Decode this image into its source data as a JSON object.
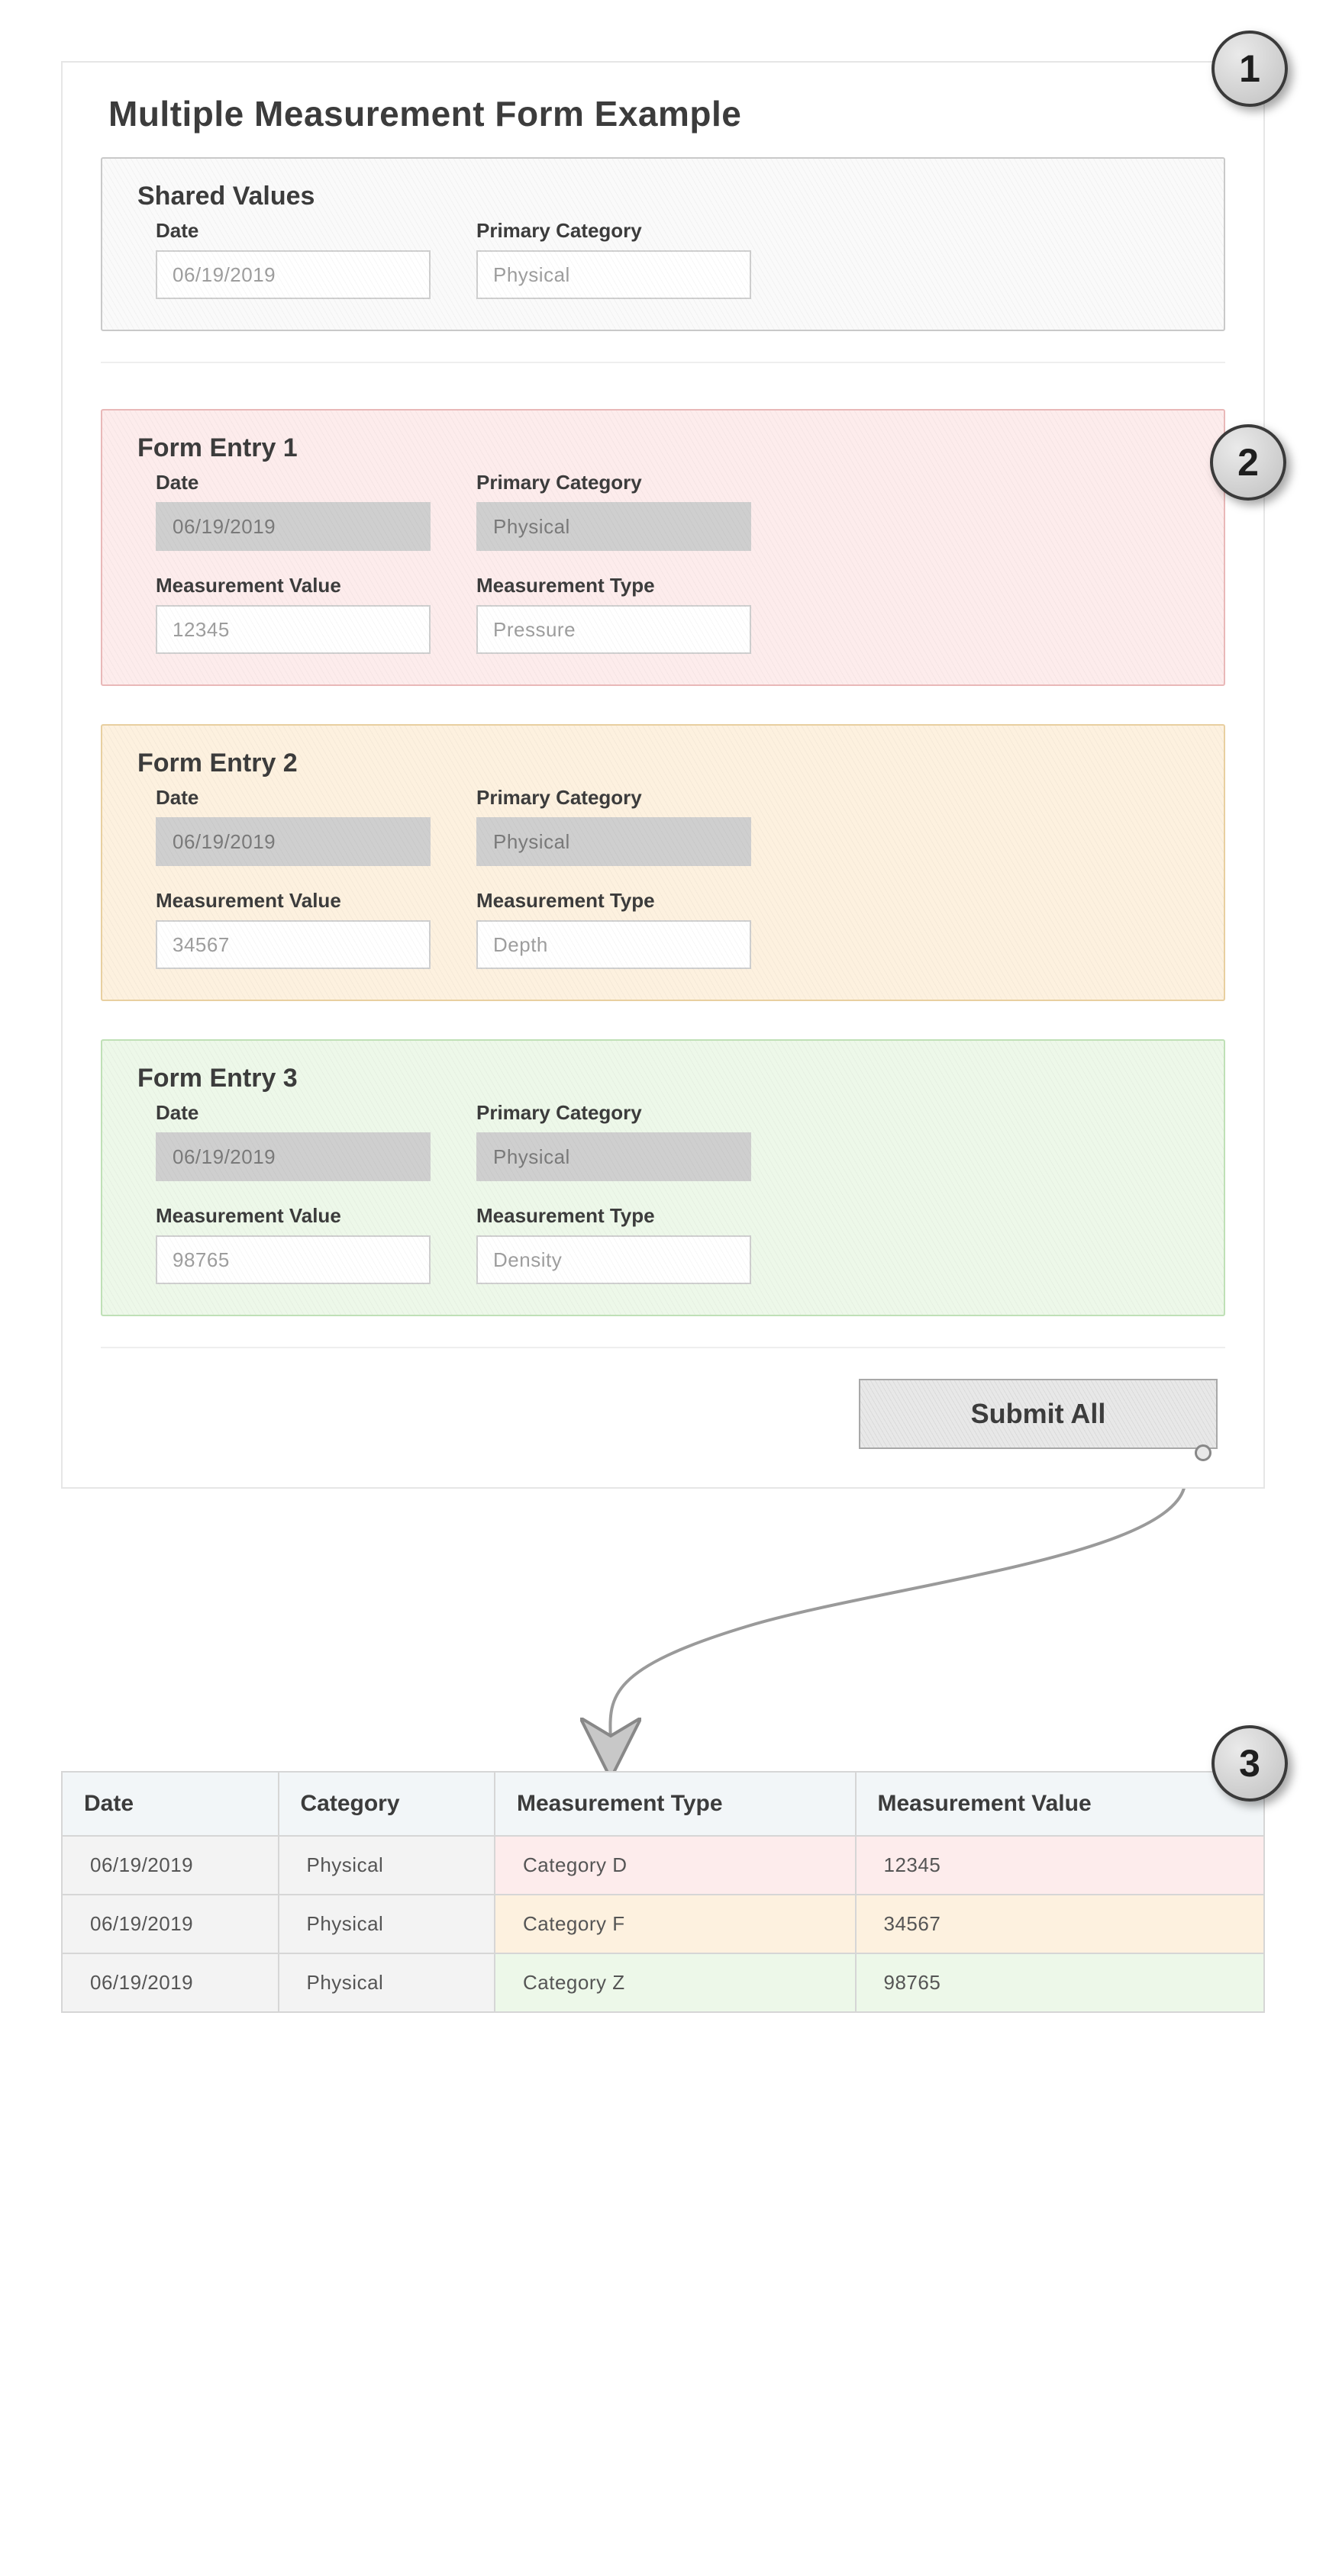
{
  "title": "Multiple Measurement Form Example",
  "callouts": {
    "c1": "1",
    "c2": "2",
    "c3": "3"
  },
  "shared": {
    "title": "Shared Values",
    "date_label": "Date",
    "date_value": "06/19/2019",
    "category_label": "Primary Category",
    "category_value": "Physical"
  },
  "entries": [
    {
      "title": "Form Entry 1",
      "date_label": "Date",
      "date_value": "06/19/2019",
      "category_label": "Primary Category",
      "category_value": "Physical",
      "value_label": "Measurement Value",
      "value_value": "12345",
      "type_label": "Measurement Type",
      "type_value": "Pressure"
    },
    {
      "title": "Form Entry 2",
      "date_label": "Date",
      "date_value": "06/19/2019",
      "category_label": "Primary Category",
      "category_value": "Physical",
      "value_label": "Measurement Value",
      "value_value": "34567",
      "type_label": "Measurement Type",
      "type_value": "Depth"
    },
    {
      "title": "Form Entry 3",
      "date_label": "Date",
      "date_value": "06/19/2019",
      "category_label": "Primary Category",
      "category_value": "Physical",
      "value_label": "Measurement Value",
      "value_value": "98765",
      "type_label": "Measurement Type",
      "type_value": "Density"
    }
  ],
  "submit_label": "Submit All",
  "table": {
    "headers": [
      "Date",
      "Category",
      "Measurement Type",
      "Measurement Value"
    ],
    "rows": [
      {
        "date": "06/19/2019",
        "category": "Physical",
        "type": "Category D",
        "value": "12345"
      },
      {
        "date": "06/19/2019",
        "category": "Physical",
        "type": "Category F",
        "value": "34567"
      },
      {
        "date": "06/19/2019",
        "category": "Physical",
        "type": "Category Z",
        "value": "98765"
      }
    ]
  }
}
